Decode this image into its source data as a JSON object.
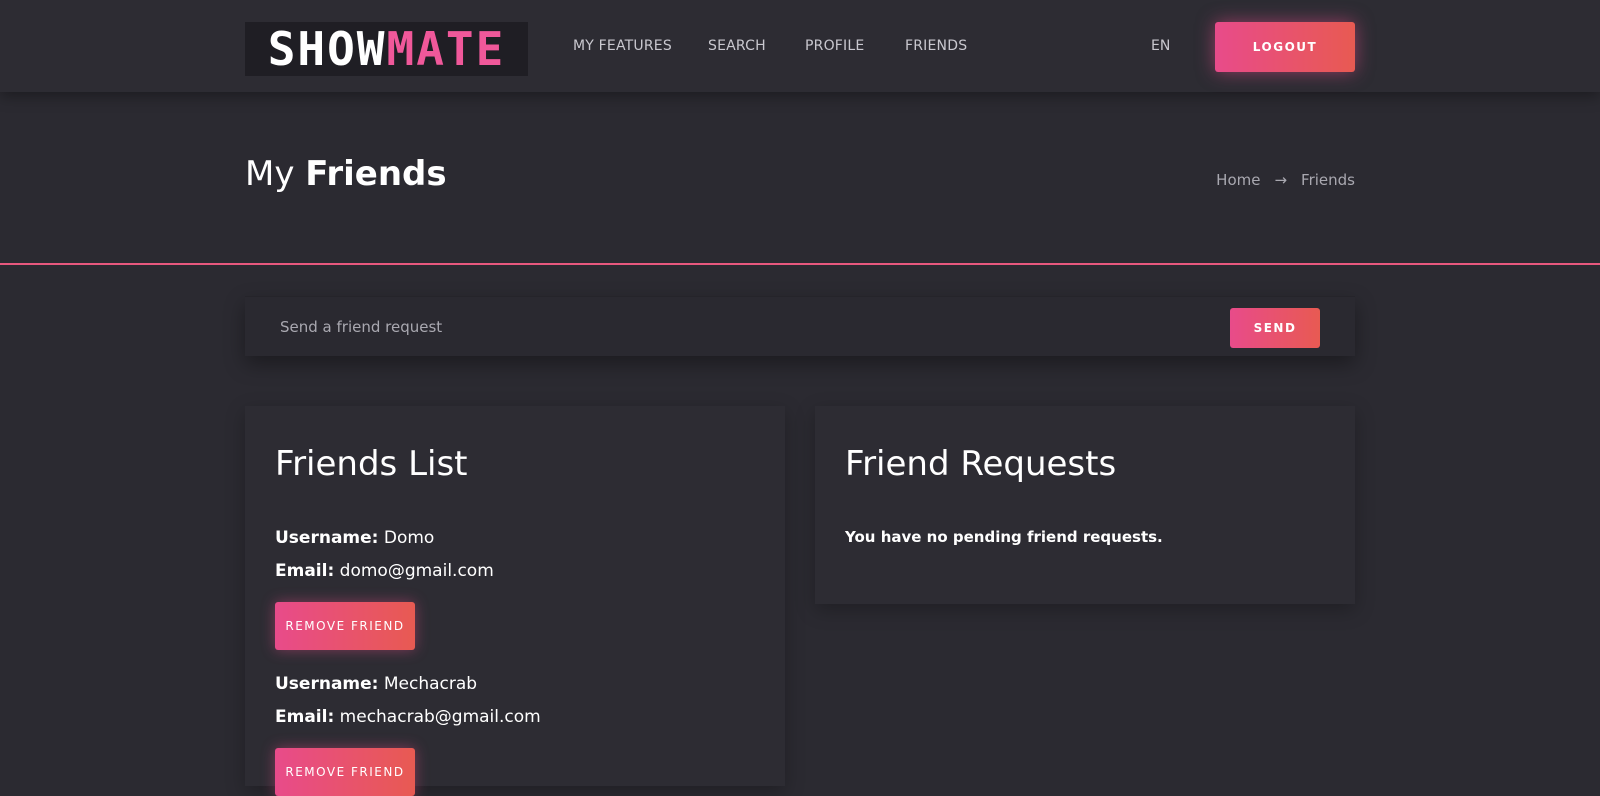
{
  "nav": {
    "logo_a": "SHOW",
    "logo_b": "MATE",
    "links": [
      "MY FEATURES",
      "SEARCH",
      "PROFILE",
      "FRIENDS"
    ],
    "lang": "EN",
    "logout": "LOGOUT"
  },
  "header": {
    "title_light": "My",
    "title_bold": "Friends",
    "breadcrumb": [
      "Home",
      "→",
      "Friends"
    ]
  },
  "request": {
    "placeholder": "Send a friend request",
    "send_label": "SEND"
  },
  "friends_list": {
    "title": "Friends List",
    "username_label": "Username:",
    "email_label": "Email:",
    "remove_label": "REMOVE FRIEND",
    "friends": [
      {
        "username": "Domo",
        "email": "domo@gmail.com"
      },
      {
        "username": "Mechacrab",
        "email": "mechacrab@gmail.com"
      }
    ]
  },
  "friend_requests": {
    "title": "Friend Requests",
    "empty_message": "You have no pending friend requests."
  },
  "colors": {
    "accent_start": "#e84b8a",
    "accent_end": "#e85a52",
    "background": "#2b2a31"
  }
}
